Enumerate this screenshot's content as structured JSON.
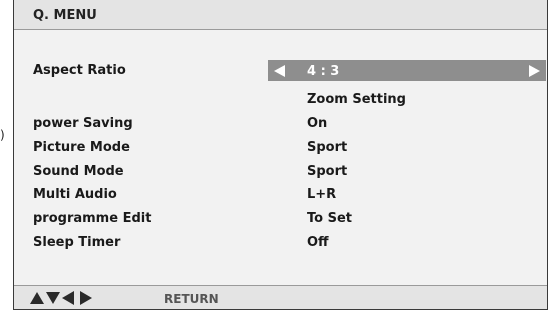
{
  "menu": {
    "title": "Q. MENU",
    "aspect_ratio": {
      "label": "Aspect Ratio",
      "value": "4 : 3"
    },
    "zoom_setting": "Zoom Setting",
    "items": [
      {
        "label": "power Saving",
        "value": "On"
      },
      {
        "label": "Picture Mode",
        "value": "Sport"
      },
      {
        "label": "Sound Mode",
        "value": "Sport"
      },
      {
        "label": "Multi Audio",
        "value": "L+R"
      },
      {
        "label": "programme Edit",
        "value": "To Set"
      },
      {
        "label": "Sleep Timer",
        "value": "Off"
      }
    ]
  },
  "footer": {
    "nav_icons": [
      "up-arrow",
      "down-arrow",
      "left-arrow",
      "right-arrow"
    ],
    "return_label": "RETURN"
  },
  "edge_mark": ")",
  "colors": {
    "background": "#f2f2f2",
    "bar": "#e4e4e4",
    "highlight": "#8e8e8e",
    "highlight_text": "#ffffff",
    "text": "#1a1a1a"
  }
}
